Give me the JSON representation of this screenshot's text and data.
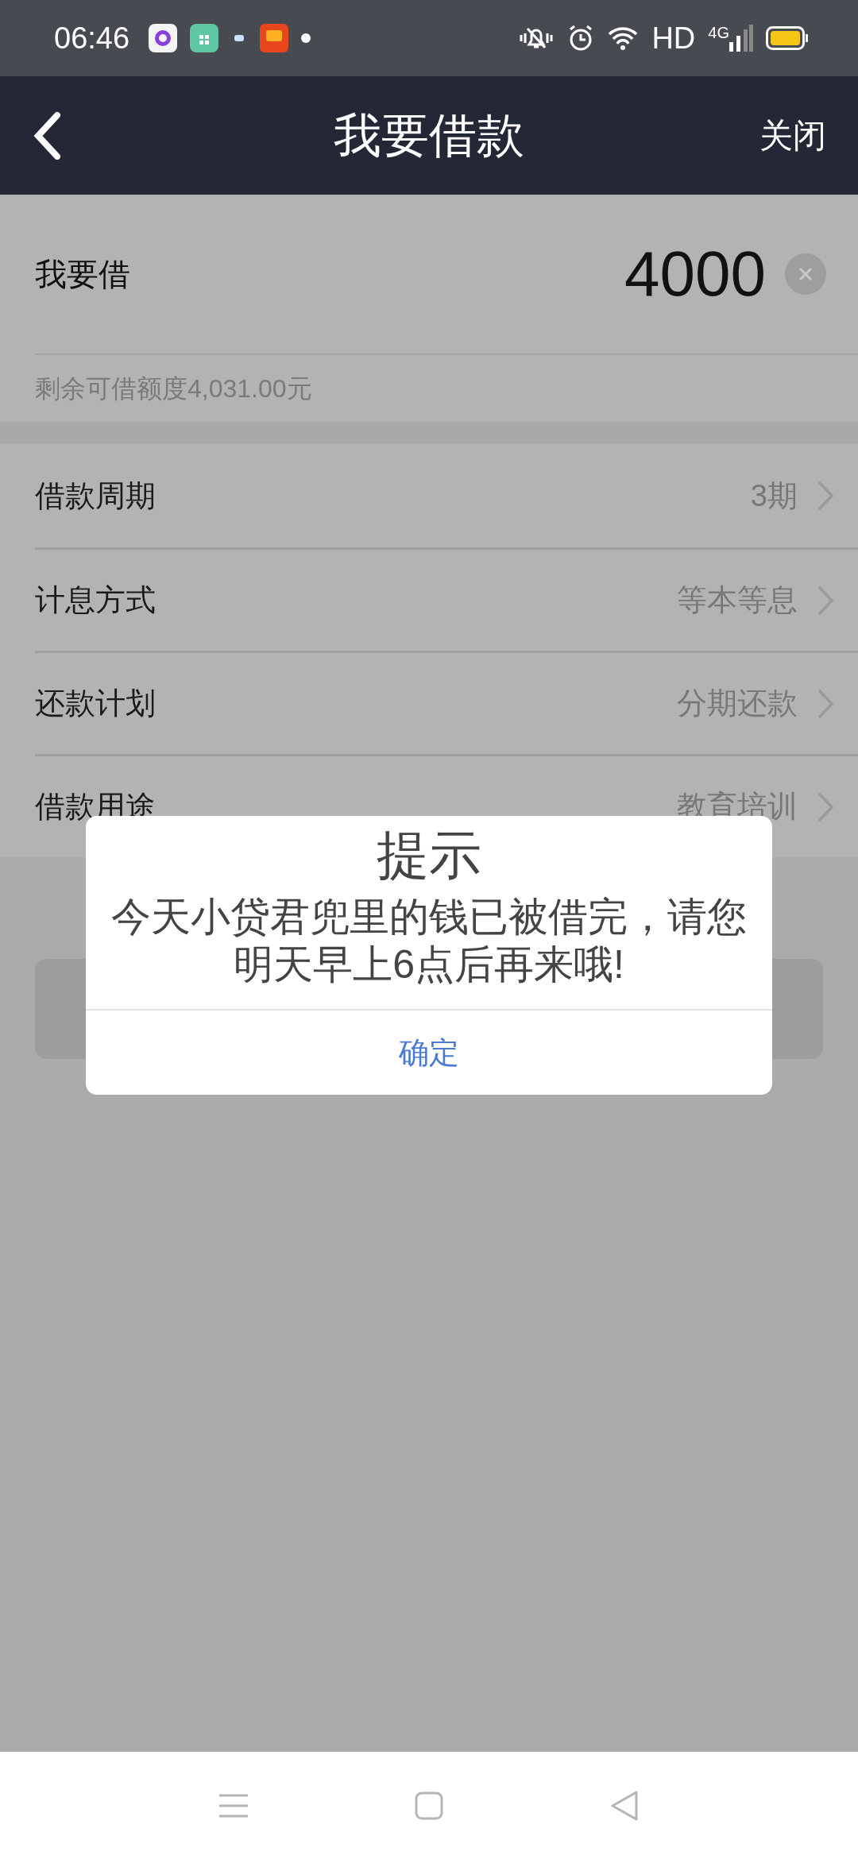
{
  "status_bar": {
    "time": "06:46",
    "network": "HD",
    "signal_type": "4G"
  },
  "header": {
    "title": "我要借款",
    "close": "关闭"
  },
  "amount": {
    "label": "我要借",
    "value": "4000",
    "remaining": "剩余可借额度4,031.00元"
  },
  "options": [
    {
      "label": "借款周期",
      "value": "3期"
    },
    {
      "label": "计息方式",
      "value": "等本等息"
    },
    {
      "label": "还款计划",
      "value": "分期还款"
    },
    {
      "label": "借款用途",
      "value": "教育培训"
    }
  ],
  "dialog": {
    "title": "提示",
    "message": "今天小贷君兜里的钱已被借完，请您明天早上6点后再来哦!",
    "button": "确定"
  }
}
